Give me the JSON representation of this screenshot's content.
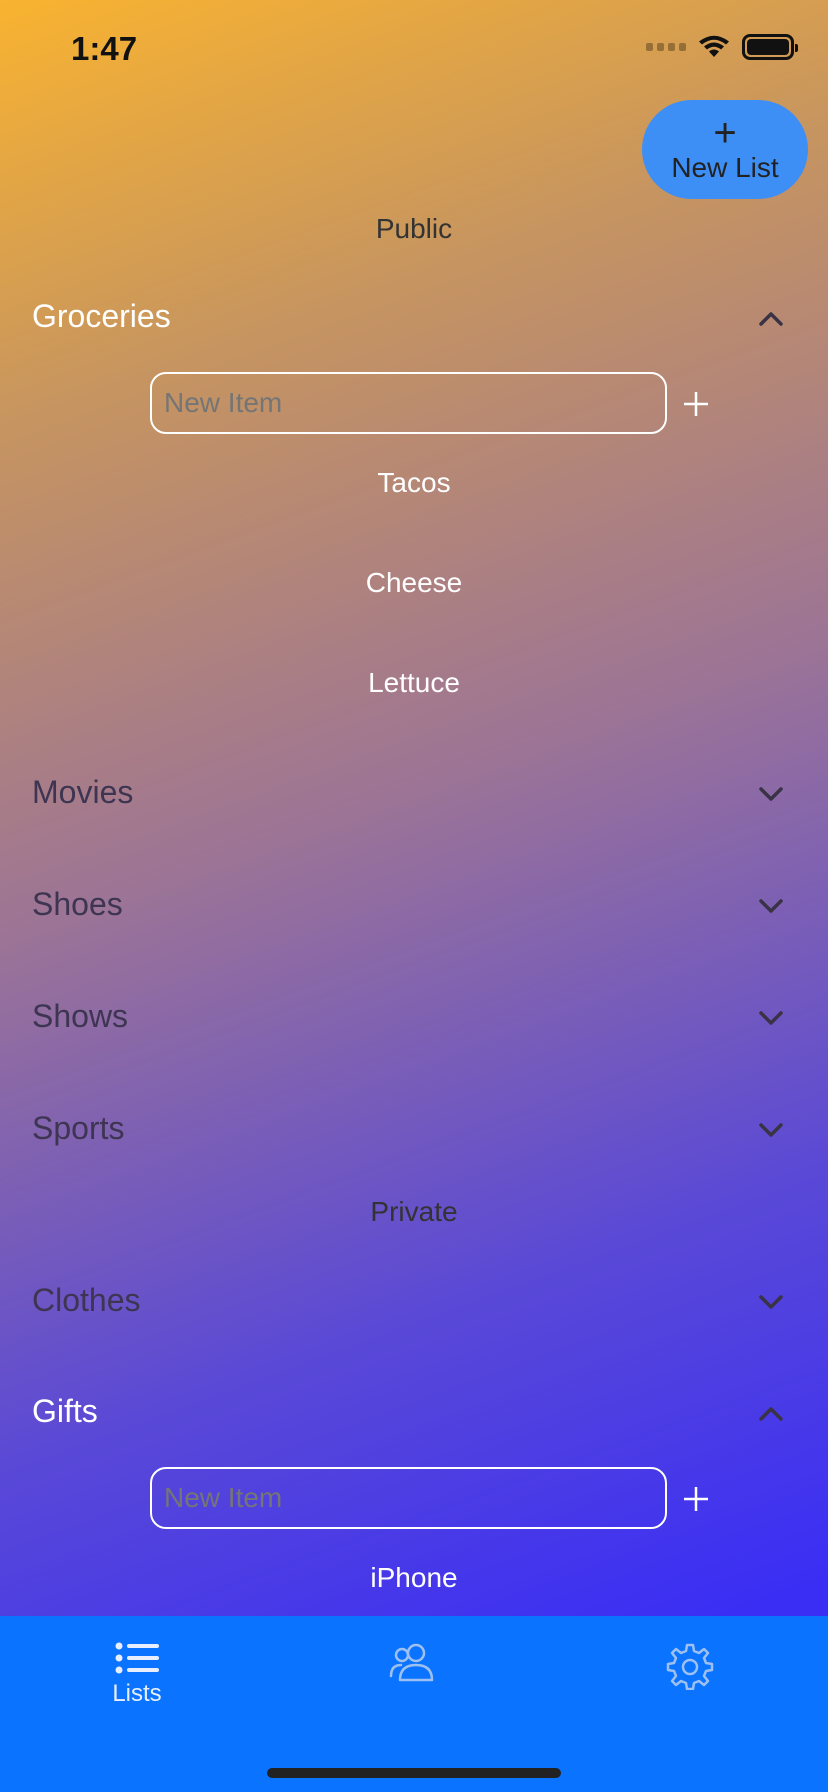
{
  "status_bar": {
    "time": "1:47"
  },
  "toolbar": {
    "new_list_icon": "plus-icon",
    "new_list_label": "New List"
  },
  "sections": {
    "public_title": "Public",
    "private_title": "Private"
  },
  "lists": {
    "groceries": {
      "name": "Groceries",
      "input_placeholder": "New Item",
      "items": [
        "Tacos",
        "Cheese",
        "Lettuce"
      ]
    },
    "movies": {
      "name": "Movies"
    },
    "shoes": {
      "name": "Shoes"
    },
    "shows": {
      "name": "Shows"
    },
    "sports": {
      "name": "Sports"
    },
    "clothes": {
      "name": "Clothes"
    },
    "gifts": {
      "name": "Gifts",
      "input_placeholder": "New Item",
      "items": [
        "iPhone"
      ]
    }
  },
  "tabs": {
    "lists": {
      "label": "Lists",
      "icon": "list-icon"
    },
    "shared": {
      "icon": "people-icon"
    },
    "settings": {
      "icon": "gear-icon"
    }
  },
  "colors": {
    "accent": "#3d8ff6",
    "tab_bar": "#0a73ff"
  }
}
